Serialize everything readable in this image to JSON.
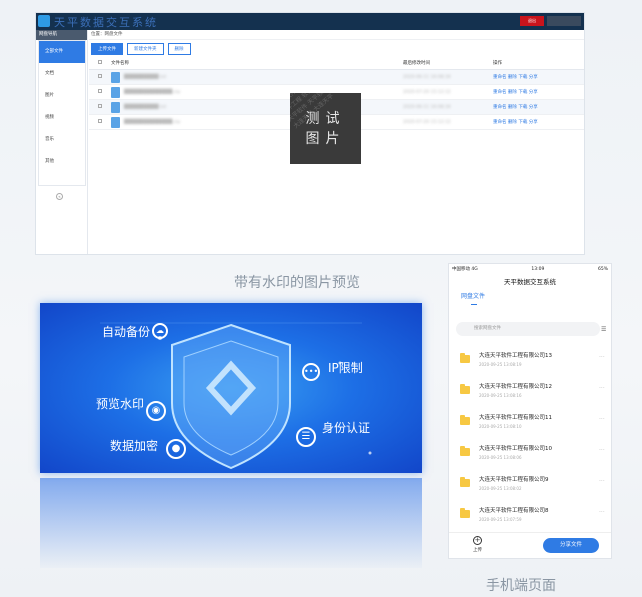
{
  "desktop": {
    "app_title": "天平数据交互系统",
    "header_btn": "退出",
    "header_user": "",
    "sidebar_head": "网盘导航",
    "sidebar": [
      "全部文件",
      "文档",
      "图片",
      "视频",
      "音乐",
      "其他"
    ],
    "breadcrumb": "位置：网盘文件",
    "toolbar": [
      "上传文件",
      "新建文件夹",
      "删除"
    ],
    "columns": [
      "文件名称",
      "最后修改时间",
      "操作"
    ],
    "files": [
      {
        "name": "██████████.txt",
        "date": "2020-06-11 16:08:34",
        "ops": "重命名 删除 下载 分享"
      },
      {
        "name": "██████████████.zip",
        "date": "2020-07-20 15:12:12",
        "ops": "重命名 删除 下载 分享"
      },
      {
        "name": "██████████.txt",
        "date": "2020-06-11 16:08:34",
        "ops": "重命名 删除 下载 分享"
      },
      {
        "name": "██████████████.zip",
        "date": "2020-07-20 15:12:12",
        "ops": "重命名 删除 下载 分享"
      }
    ],
    "watermark": [
      "测试",
      "图片"
    ],
    "watermark_pattern": "天平软件 天平软件\n软件工程 软件工程\n天平软件 天平软件\n大连天平 大连天平"
  },
  "caption_left": "带有水印的图片预览",
  "banner": {
    "labels": [
      "自动备份",
      "IP限制",
      "预览水印",
      "身份认证",
      "数据加密"
    ]
  },
  "phone": {
    "status_left": "中国移动 4G",
    "status_time": "13:09",
    "status_right": "65%",
    "title": "天平数据交互系统",
    "tab": "网盘文件",
    "search_placeholder": "搜索网盘文件",
    "items": [
      {
        "name": "大连天平软件工程有限公司13",
        "date": "2020-09-25 13:08:19"
      },
      {
        "name": "大连天平软件工程有限公司12",
        "date": "2020-09-25 13:08:16"
      },
      {
        "name": "大连天平软件工程有限公司11",
        "date": "2020-09-25 13:08:10"
      },
      {
        "name": "大连天平软件工程有限公司10",
        "date": "2020-09-25 13:08:06"
      },
      {
        "name": "大连天平软件工程有限公司9",
        "date": "2020-09-25 13:08:02"
      },
      {
        "name": "大连天平软件工程有限公司8",
        "date": "2020-09-25 13:07:59"
      }
    ],
    "upload": "上传",
    "share": "分享文件"
  },
  "caption_right": "手机端页面",
  "colors": {
    "accent": "#2f7be4",
    "header": "#14314f",
    "folder": "#f7c843",
    "danger": "#c9141c"
  }
}
